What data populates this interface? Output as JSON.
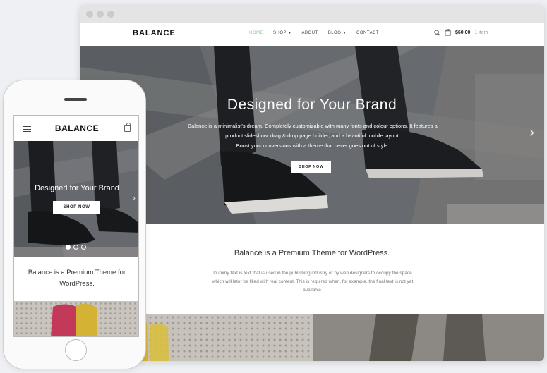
{
  "site": {
    "logo": "BALANCE",
    "nav": [
      {
        "label": "HOME",
        "active": true
      },
      {
        "label": "SHOP",
        "dropdown": true
      },
      {
        "label": "ABOUT"
      },
      {
        "label": "BLOG",
        "dropdown": true
      },
      {
        "label": "CONTACT"
      }
    ],
    "cart": {
      "price": "$60.00",
      "items": "1 item"
    }
  },
  "hero": {
    "title": "Designed for Your Brand",
    "text_lines": [
      "Balance is a minimalist's dream. Completely customizable with many fonts and colour options. It features a",
      "product slideshow, drag & drop page builder, and a beautiful mobile layout.",
      "Boost your conversions with a theme that never goes out of style."
    ],
    "button": "SHOP NOW",
    "slides": 3,
    "active_slide": 1
  },
  "intro": {
    "title": "Balance is a Premium Theme for WordPress.",
    "paragraph_lines": [
      "Dummy text is text that is used in the publishing industry or by web designers to occupy the space",
      "which will later be filled with real content. This is required when, for example, the final text is not yet",
      "available."
    ]
  },
  "mobile": {
    "logo": "BALANCE",
    "hero_title": "Designed for Your Brand",
    "button": "SHOP NOW",
    "intro_lines": [
      "Balance is a Premium Theme for",
      "WordPress."
    ]
  },
  "colors": {
    "accent": "#8fc4a2",
    "background": "#eef0f3"
  },
  "icons": [
    "search-icon",
    "cart-icon",
    "menu-icon",
    "bag-icon",
    "chevron-right-icon",
    "chevron-down-icon"
  ]
}
